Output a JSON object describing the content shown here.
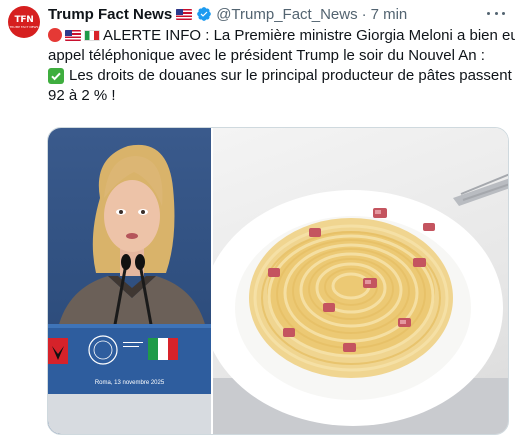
{
  "account": {
    "avatar_text": "TFN",
    "avatar_subtext": "TRUMP FACT NEWS",
    "display_name": "Trump Fact News",
    "handle": "@Trump_Fact_News",
    "separator": "·",
    "time": "7 min"
  },
  "post": {
    "line1": "ALERTE INFO : La Première ministre Giorgia Meloni a bien eu un",
    "line2": "appel téléphonique avec le président Trump le soir du Nouvel An :",
    "line3": "Les droits de douanes sur le principal producteur de pâtes passent de",
    "line4": "92 à 2 % !"
  },
  "media": {
    "left_photo_caption": "Roma, 13 novembre 2025"
  },
  "colors": {
    "avatar_red": "#d61f1f",
    "verified_blue": "#1d9bf0",
    "muted_text": "#536471",
    "check_green": "#3fae3f"
  },
  "icons": {
    "verified": "verified-badge-icon",
    "more": "more-options-icon",
    "check": "check-mark-icon"
  }
}
